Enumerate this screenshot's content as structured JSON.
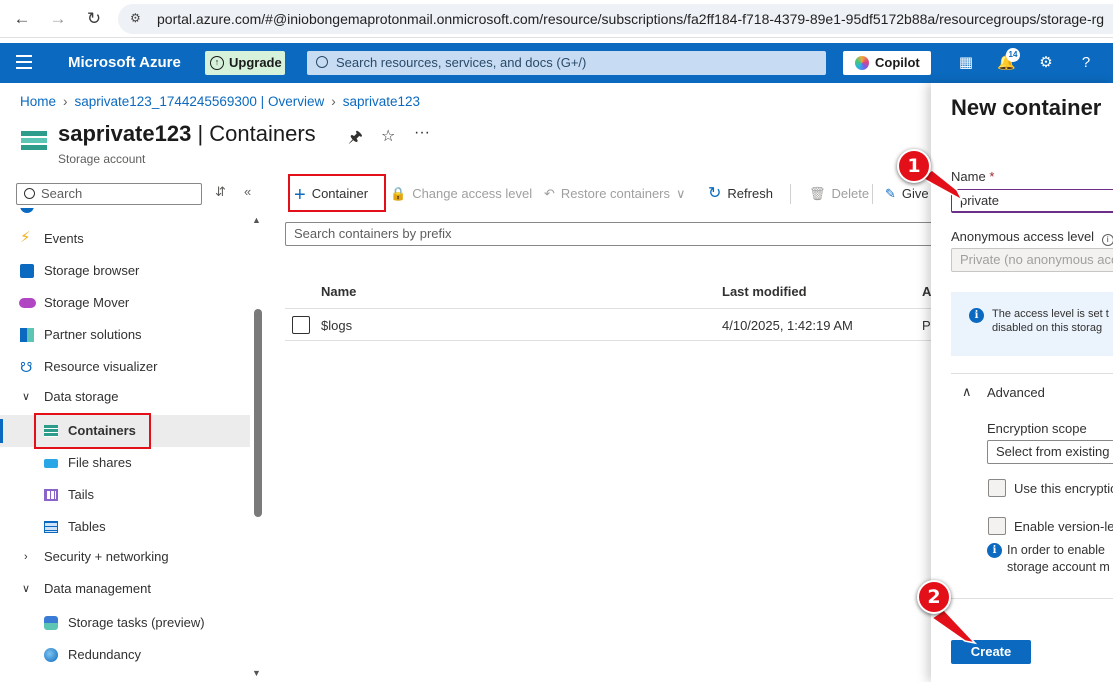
{
  "browser": {
    "url": "portal.azure.com/#@iniobongemaprotonmail.onmicrosoft.com/resource/subscriptions/fa2ff184-f718-4379-89e1-95df5172b88a/resourcegroups/storage-rg"
  },
  "header": {
    "brand": "Microsoft Azure",
    "upgrade": "Upgrade",
    "search_placeholder": "Search resources, services, and docs (G+/)",
    "copilot": "Copilot",
    "notification_count": "14"
  },
  "breadcrumb": [
    "Home",
    "saprivate123_1744245569300 | Overview",
    "saprivate123"
  ],
  "resource": {
    "name": "saprivate123",
    "section": "Containers",
    "type": "Storage account"
  },
  "sidebar": {
    "search_placeholder": "Search",
    "items": [
      {
        "label": "Events"
      },
      {
        "label": "Storage browser"
      },
      {
        "label": "Storage Mover"
      },
      {
        "label": "Partner solutions"
      },
      {
        "label": "Resource visualizer"
      },
      {
        "label": "Data storage"
      },
      {
        "label": "Containers"
      },
      {
        "label": "File shares"
      },
      {
        "label": "Tails"
      },
      {
        "label": "Tables"
      },
      {
        "label": "Security + networking"
      },
      {
        "label": "Data management"
      },
      {
        "label": "Storage tasks (preview)"
      },
      {
        "label": "Redundancy"
      }
    ]
  },
  "toolbar": {
    "container": "Container",
    "change_access": "Change access level",
    "restore": "Restore containers",
    "refresh": "Refresh",
    "delete": "Delete",
    "give": "Give"
  },
  "list": {
    "search_placeholder": "Search containers by prefix",
    "columns": [
      "Name",
      "Last modified",
      "A"
    ],
    "rows": [
      {
        "name": "$logs",
        "modified": "4/10/2025, 1:42:19 AM",
        "access": "P"
      }
    ]
  },
  "panel": {
    "title": "New container",
    "name_label": "Name",
    "required_mark": "*",
    "name_value": "private",
    "access_label": "Anonymous access level",
    "access_value": "Private (no anonymous access)",
    "info_line1": "The access level is set t",
    "info_line2": "disabled on this storag",
    "advanced": "Advanced",
    "encryption_label": "Encryption scope",
    "encryption_value": "Select from existing",
    "use_encryption": "Use this encryptio",
    "enable_version": "Enable version-lev",
    "version_info1": "In order to enable",
    "version_info2": "storage account m",
    "create": "Create"
  },
  "annotations": {
    "marker1": "1",
    "marker2": "2"
  },
  "colors": {
    "azure_blue": "#0b6abf",
    "highlight_red": "#e3101a"
  }
}
